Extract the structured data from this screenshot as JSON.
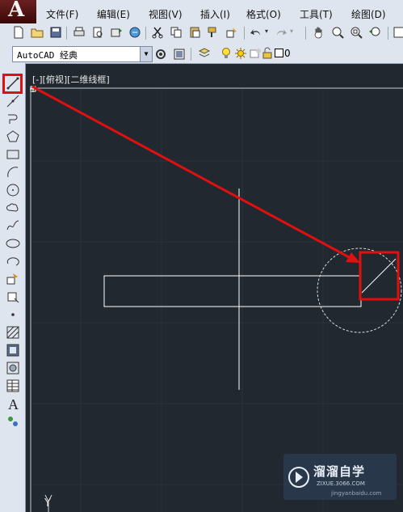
{
  "menubar": {
    "items": [
      "文件(F)",
      "编辑(E)",
      "视图(V)",
      "插入(I)",
      "格式(O)",
      "工具(T)",
      "绘图(D)"
    ]
  },
  "toolbar2": {
    "workspace": "AutoCAD 经典",
    "layer": "0"
  },
  "viewport": {
    "label": "[-][俯视][二维线框]"
  },
  "watermark": {
    "brand": "溜溜自学",
    "sub": "ZIXUE.3066.COM",
    "url": "jingyanbaidu.com"
  },
  "ucs": {
    "y_label": "Y"
  },
  "colors": {
    "canvas": "#212830",
    "highlight": "#e01010",
    "linework": "#ffffff"
  }
}
